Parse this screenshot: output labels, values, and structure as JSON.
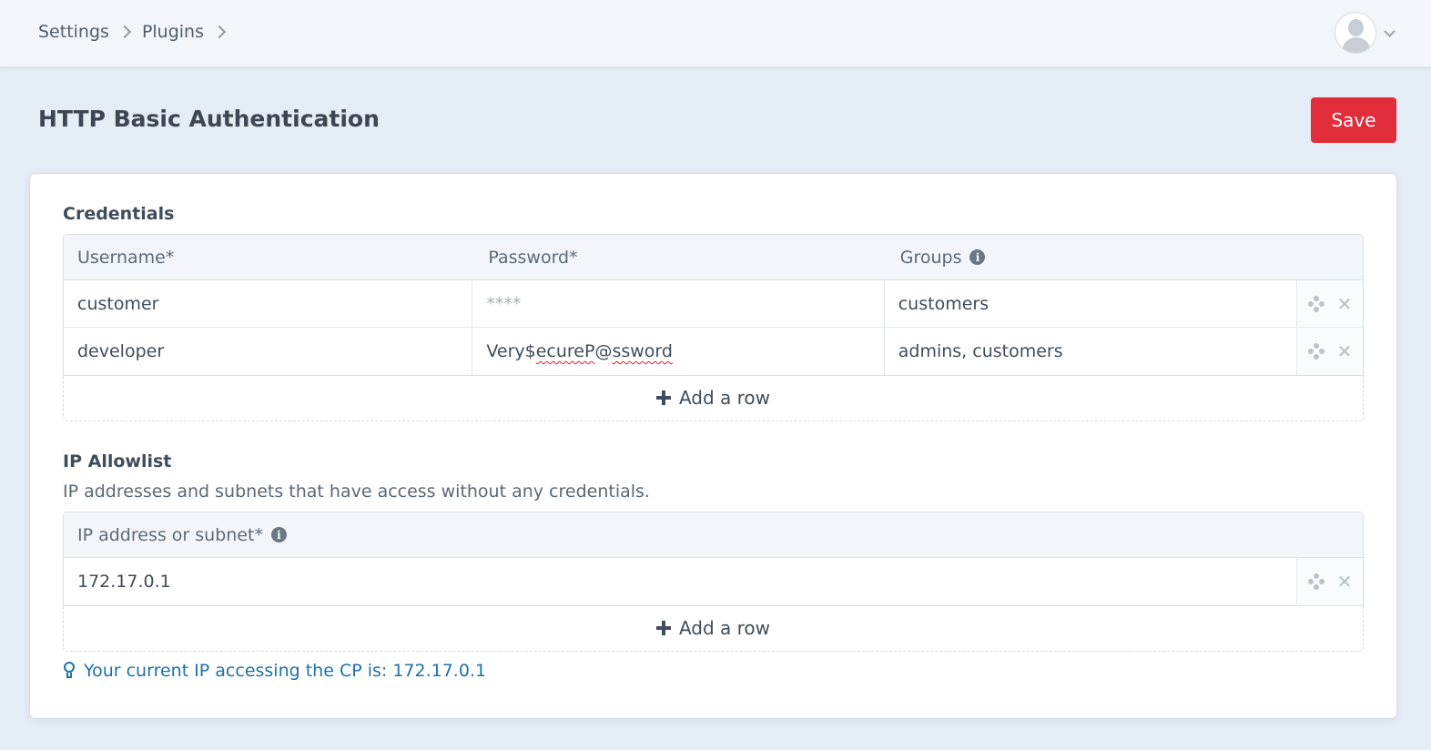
{
  "breadcrumb": {
    "items": [
      "Settings",
      "Plugins"
    ]
  },
  "header": {
    "title": "HTTP Basic Authentication",
    "save_label": "Save"
  },
  "credentials": {
    "heading": "Credentials",
    "columns": [
      "Username*",
      "Password*",
      "Groups"
    ],
    "rows": [
      {
        "username": "customer",
        "password": "****",
        "groups": "customers"
      },
      {
        "username": "developer",
        "password_parts": [
          "Very$",
          "ecureP",
          "@",
          "ssword"
        ],
        "groups": "admins, customers"
      }
    ],
    "add_row_label": "Add a row"
  },
  "allowlist": {
    "heading": "IP Allowlist",
    "description": "IP addresses and subnets that have access without any credentials.",
    "column": "IP address or subnet*",
    "rows": [
      {
        "ip": "172.17.0.1"
      }
    ],
    "add_row_label": "Add a row",
    "current_ip_note": "Your current IP accessing the CP is: 172.17.0.1"
  },
  "icons": {
    "info": "info-circle-icon",
    "move": "move-icon",
    "delete": "x-icon",
    "add": "plus-icon",
    "tip": "lightbulb-icon"
  },
  "colors": {
    "accent": "#e12c3a",
    "link": "#1d72a8",
    "background": "#e4ecf5"
  }
}
